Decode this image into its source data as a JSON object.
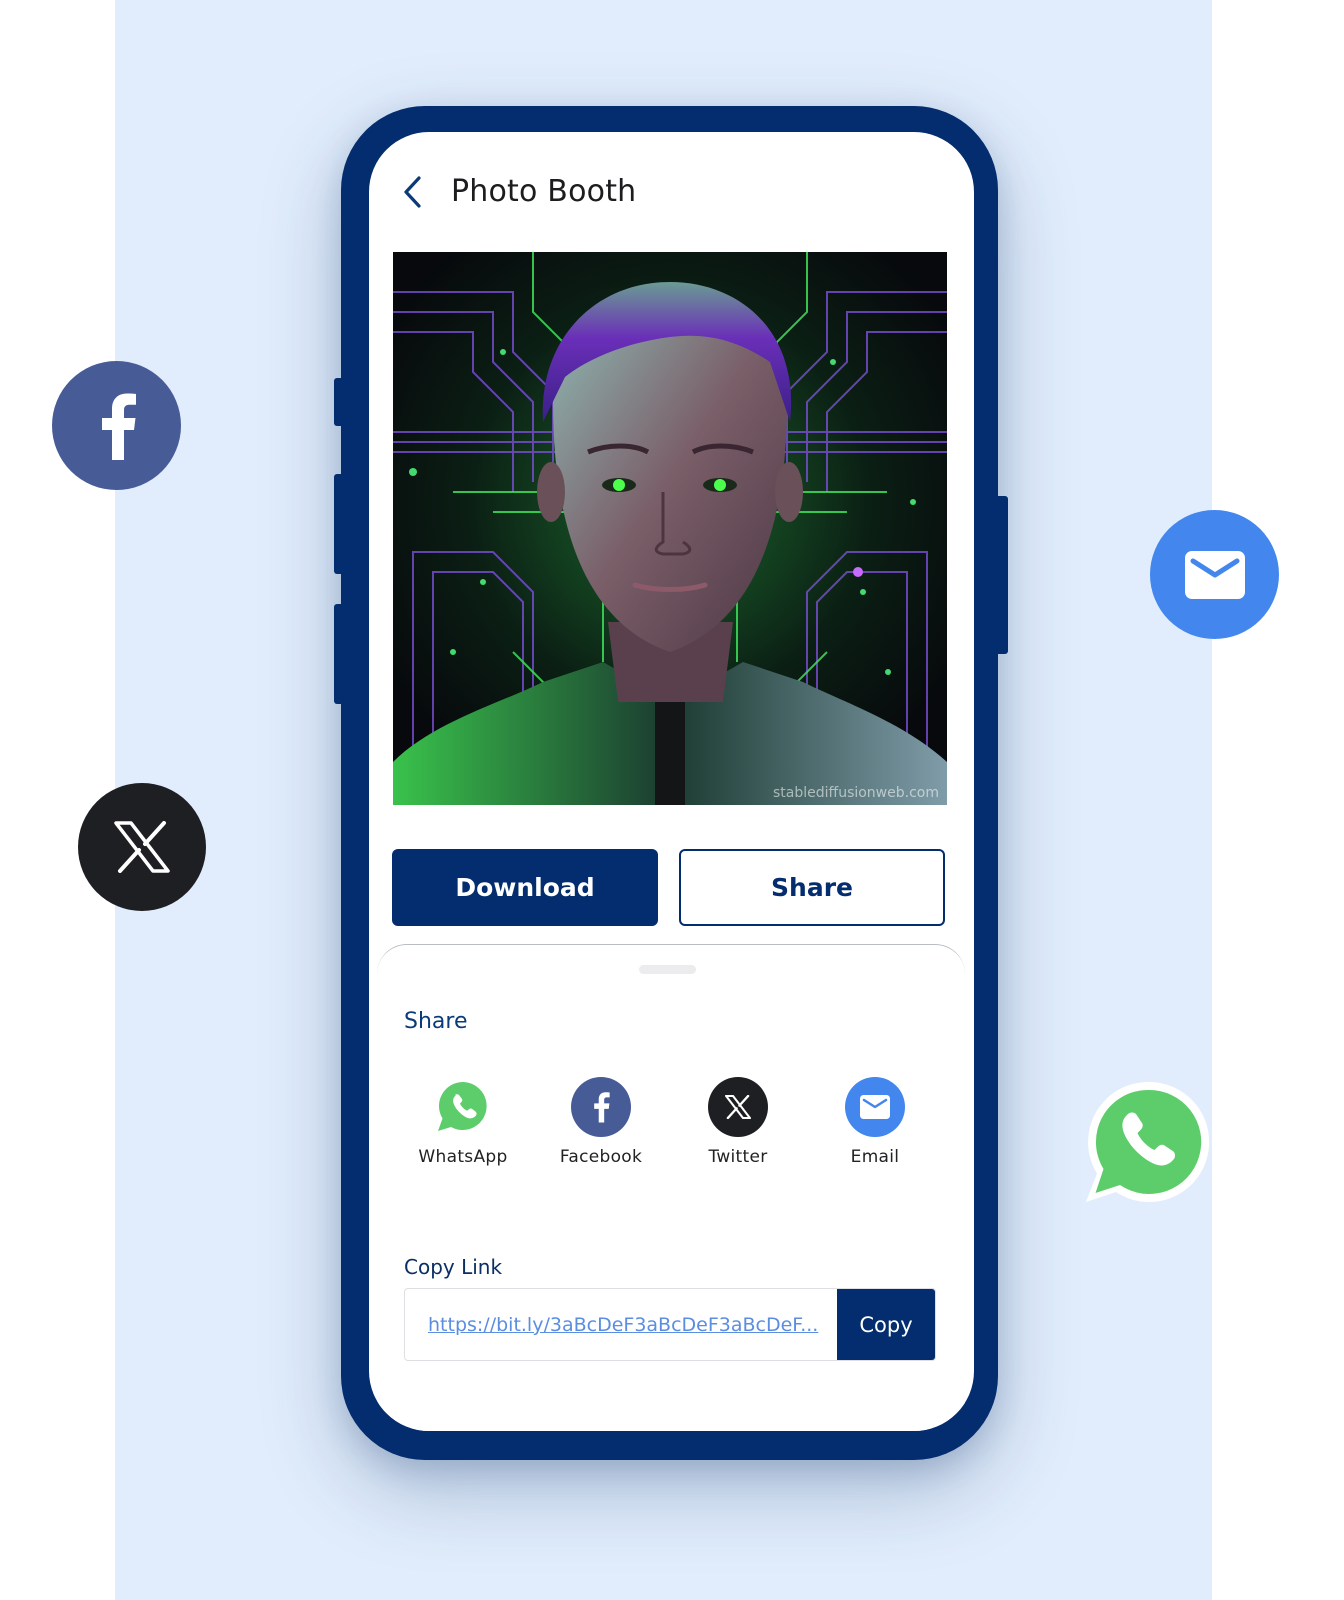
{
  "colors": {
    "brand_navy": "#032d6e",
    "background_panel": "#e1edfc",
    "whatsapp_green": "#5dcd6b",
    "facebook_blue": "#475b97",
    "x_black": "#1e1f22",
    "email_blue": "#4286ee",
    "link_blue": "#5b8ee0"
  },
  "header": {
    "back_icon": "chevron-left-icon",
    "title": "Photo Booth"
  },
  "photo": {
    "description": "AI portrait of man with purple hair and glowing green eyes on circuit-board background",
    "watermark": "stablediffusionweb.com"
  },
  "actions": {
    "download_label": "Download",
    "share_label": "Share"
  },
  "share_sheet": {
    "title": "Share",
    "options": [
      {
        "label": "WhatsApp",
        "icon": "whatsapp-icon"
      },
      {
        "label": "Facebook",
        "icon": "facebook-icon"
      },
      {
        "label": "Twitter",
        "icon": "x-twitter-icon"
      },
      {
        "label": "Email",
        "icon": "email-icon"
      }
    ],
    "copy_link": {
      "label": "Copy Link",
      "value": "https://bit.ly/3aBcDeF3aBcDeF3aBcDeF...",
      "button_label": "Copy"
    }
  },
  "floating_icons": [
    "facebook-icon",
    "x-twitter-icon",
    "email-icon",
    "whatsapp-icon"
  ]
}
